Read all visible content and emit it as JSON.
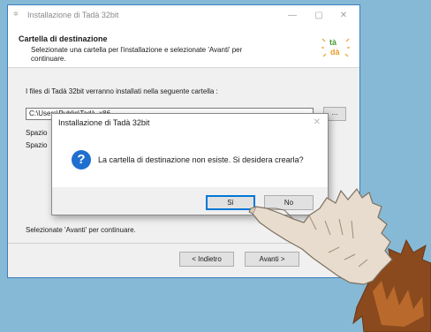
{
  "window": {
    "title": "Installazione di Tadà 32bit",
    "app_icon": "tada-small-icon",
    "header_title": "Cartella di destinazione",
    "header_subtitle": "Selezionate una cartella per l'installazione e selezionate 'Avanti' per continuare.",
    "logo_text": "tà dà"
  },
  "body": {
    "info_text": "I files di Tadà 32bit verranno installati nella seguente cartella :",
    "path_value": "C:\\Users\\Public\\Tadà_x86",
    "browse_label": "...",
    "space_label_1": "Spazio",
    "space_label_2": "Spazio",
    "footer_hint": "Selezionate 'Avanti' per continuare."
  },
  "buttons": {
    "back": "< Indietro",
    "next": "Avanti >"
  },
  "dialog": {
    "title": "Installazione di Tadà 32bit",
    "message": "La cartella di destinazione non esiste. Si desidera crearla?",
    "icon": "question-icon",
    "yes": "Sì",
    "no": "No"
  },
  "colors": {
    "background": "#86b9d6",
    "window_border": "#3c7ec0",
    "question_icon": "#1f6fd0",
    "focus": "#0078d7"
  }
}
